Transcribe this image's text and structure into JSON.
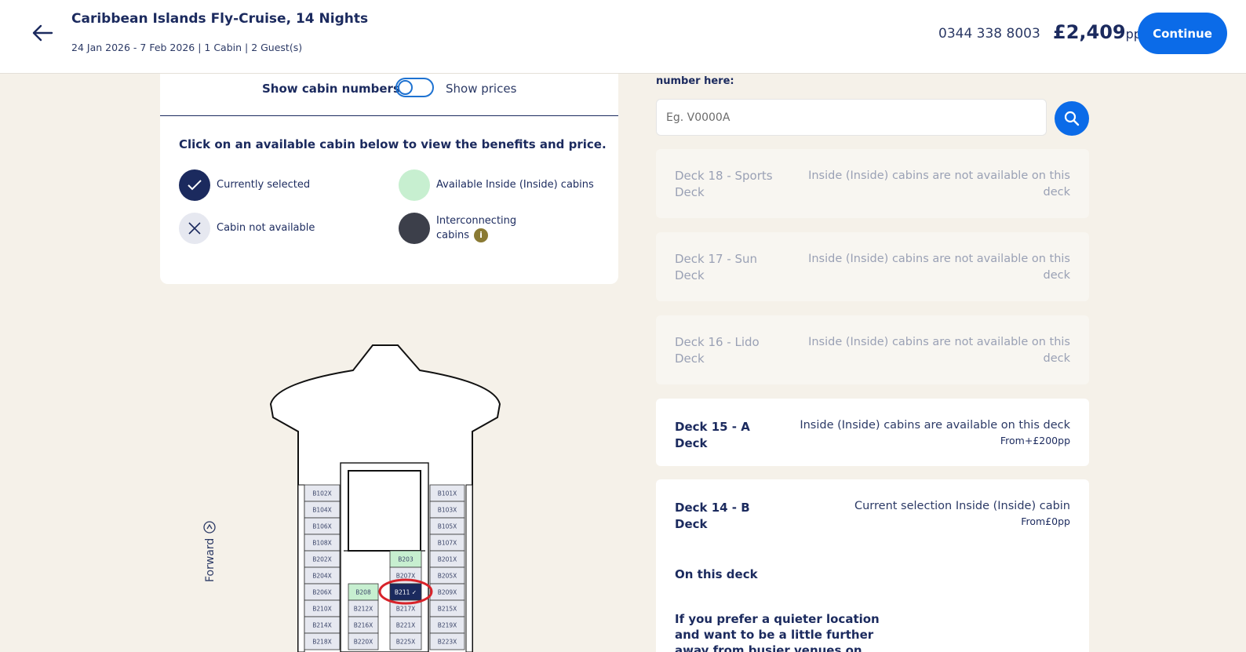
{
  "header": {
    "title": "Caribbean Islands Fly-Cruise, 14 Nights",
    "subtitle": "24 Jan 2026 - 7 Feb 2026  | 1 Cabin | 2 Guest(s)",
    "phone": "0344 338 8003",
    "price": "£2,409",
    "price_unit": "pp",
    "continue_label": "Continue"
  },
  "cabin_options": {
    "show_numbers_label": "Show cabin numbers",
    "show_prices_label": "Show prices",
    "toggle_on": false,
    "instruction": "Click on an available cabin below to view the benefits and price.",
    "legend": {
      "selected": "Currently selected",
      "available": "Available Inside (Inside) cabins",
      "not_available": "Cabin not available",
      "interconnecting": "Interconnecting cabins"
    }
  },
  "deck_plan": {
    "forward_label": "Forward",
    "cabins_left": [
      "B102X",
      "B104X",
      "B106X",
      "B108X",
      "B202X",
      "B204X",
      "B206X",
      "B210X",
      "B214X",
      "B218X"
    ],
    "cabins_center_left": [
      "B208",
      "B212X",
      "B216X",
      "B220X"
    ],
    "cabins_center_right": [
      "B203",
      "B207X",
      "B211",
      "B217X",
      "B221X",
      "B225X"
    ],
    "cabins_right": [
      "B101X",
      "B103X",
      "B105X",
      "B107X",
      "B201X",
      "B205X",
      "B209X",
      "B215X",
      "B219X",
      "B223X"
    ],
    "selected_cabin": "B211"
  },
  "search": {
    "label": "number here:",
    "placeholder": "Eg. V0000A"
  },
  "decks": [
    {
      "name": "Deck 18 - Sports Deck",
      "status": "Inside (Inside) cabins are not available on this deck",
      "available": false
    },
    {
      "name": "Deck 17 - Sun Deck",
      "status": "Inside (Inside) cabins are not available on this deck",
      "available": false
    },
    {
      "name": "Deck 16 - Lido Deck",
      "status": "Inside (Inside) cabins are not available on this deck",
      "available": false
    },
    {
      "name": "Deck 15 - A Deck",
      "status": "Inside (Inside) cabins are available on this deck",
      "from": "From+£200pp",
      "available": true
    },
    {
      "name": "Deck 14 - B Deck",
      "status": "Current selection Inside (Inside) cabin",
      "from": "From£0pp",
      "available": true,
      "current": true
    }
  ],
  "deck_detail": {
    "title": "On this deck",
    "text": "If you prefer a quieter location and want to be a little further away from busier venues on board"
  },
  "colors": {
    "accent": "#0b6be8",
    "navy": "#1b2a5e",
    "available_green": "#c7efd0",
    "interconnect": "#3c3f4a",
    "highlight_ring": "#d8232a"
  }
}
